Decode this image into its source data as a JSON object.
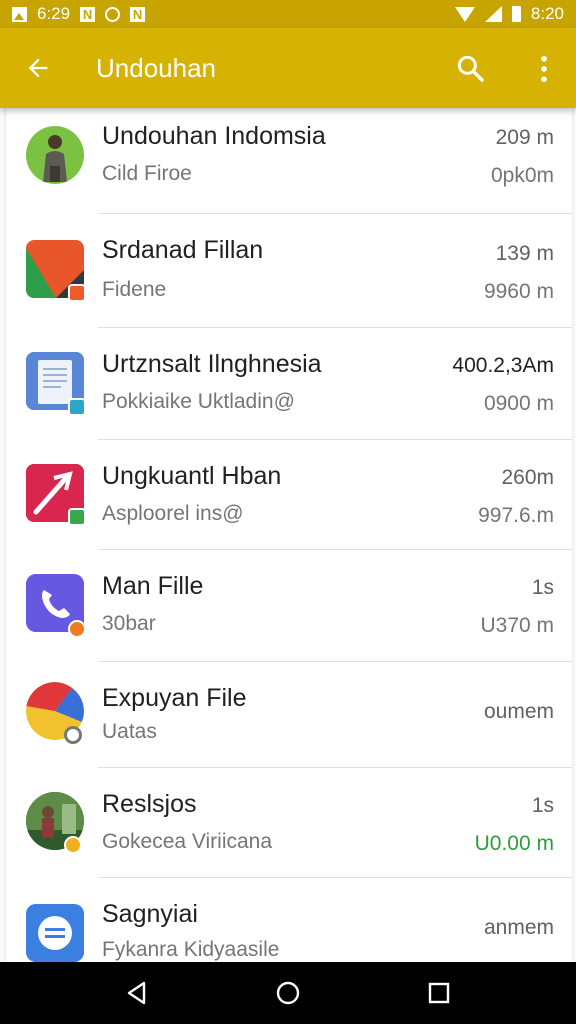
{
  "status_bar": {
    "time_left": "6:29",
    "time_right": "8:20",
    "icons": [
      "photo-icon",
      "n-icon",
      "sync-icon",
      "n-icon",
      "wifi-icon",
      "signal-icon",
      "battery-icon"
    ]
  },
  "app_bar": {
    "title": "Undouhan",
    "icons": [
      "back-arrow-icon",
      "search-icon",
      "more-vert-icon"
    ],
    "color": "#d6b303"
  },
  "list": {
    "items": [
      {
        "title": "Undouhan Indomsia",
        "subtitle": "Cild Firoe",
        "meta_top": "209 m",
        "meta_bottom": "0pk0m",
        "icon": "person-photo-icon"
      },
      {
        "title": "Srdanad Fillan",
        "subtitle": "Fidene",
        "meta_top": "139 m",
        "meta_bottom": "9960 m",
        "icon": "slides-app-icon"
      },
      {
        "title": "Urtznsalt Ilnghnesia",
        "subtitle": "Pokkiaike Uktladin@",
        "meta_top": "400.2,3Am",
        "meta_bottom": "0900 m",
        "icon": "document-icon"
      },
      {
        "title": "Ungkuantl Hban",
        "subtitle": "Asploorel ins@",
        "meta_top": "260m",
        "meta_bottom": "997.6.m",
        "icon": "arrow-app-icon"
      },
      {
        "title": "Man Fille",
        "subtitle": "30bar",
        "meta_top": "1s",
        "meta_bottom": "U370 m",
        "icon": "phone-icon"
      },
      {
        "title": "Expuyan File",
        "subtitle": "Uatas",
        "meta_top": "oumem",
        "meta_bottom": "",
        "icon": "chrome-like-icon"
      },
      {
        "title": "Reslsjos",
        "subtitle": "Gokecea Viriicana",
        "meta_top": "1s",
        "meta_bottom": "U0.00 m",
        "icon": "photo-avatar-icon",
        "meta_bottom_color": "#2e9e3a"
      },
      {
        "title": "Sagnyiai",
        "subtitle": "Fykanra Kidyaasile",
        "meta_top": "anmem",
        "meta_bottom": "",
        "icon": "message-icon"
      }
    ]
  },
  "nav_bar": {
    "icons": [
      "nav-back-icon",
      "nav-home-icon",
      "nav-recents-icon"
    ]
  }
}
